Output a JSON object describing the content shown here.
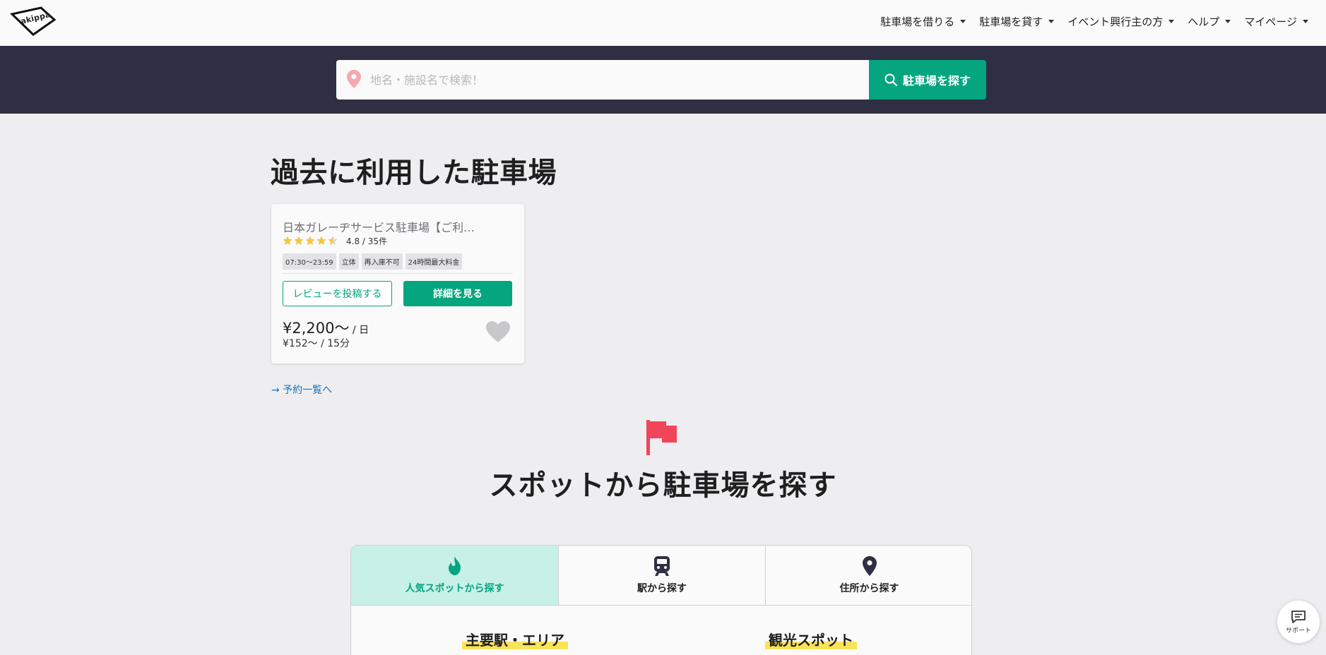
{
  "header": {
    "logo_text": "akippa",
    "nav": [
      {
        "label": "駐車場を借りる"
      },
      {
        "label": "駐車場を貸す"
      },
      {
        "label": "イベント興行主の方"
      },
      {
        "label": "ヘルプ"
      },
      {
        "label": "マイページ"
      }
    ]
  },
  "search": {
    "placeholder": "地名・施設名で検索！",
    "value": "",
    "button_label": "駐車場を探す"
  },
  "past_parking": {
    "title": "過去に利用した駐車場",
    "card": {
      "name": "日本ガレーヂサービス駐車場【ご利…",
      "stars": 4.5,
      "rating_text": "4.8 / 35件",
      "tags": [
        "07:30〜23:59",
        "立体",
        "再入庫不可",
        "24時間最大料金"
      ],
      "review_button": "レビューを投稿する",
      "detail_button": "詳細を見る",
      "price_day": "¥2,200〜",
      "price_day_unit": " / 日",
      "price_min": "¥152〜 / 15分"
    },
    "reservations_link": "→ 予約一覧へ"
  },
  "spot_search": {
    "title": "スポットから駐車場を探す",
    "tabs": [
      {
        "label": "人気スポットから探す",
        "icon": "flame-icon",
        "active": true
      },
      {
        "label": "駅から探す",
        "icon": "train-icon",
        "active": false
      },
      {
        "label": "住所から探す",
        "icon": "location-pin-icon",
        "active": false
      }
    ],
    "subheadings": {
      "area": "主要駅・エリア",
      "tourism": "観光スポット"
    }
  },
  "support": {
    "label": "サポート"
  },
  "colors": {
    "accent": "#04a57f",
    "header_band": "#2e2f42",
    "flag": "#f0455b",
    "link": "#1a72b4",
    "active_tab": "#c7f1e8",
    "highlight": "#f9e35a"
  }
}
